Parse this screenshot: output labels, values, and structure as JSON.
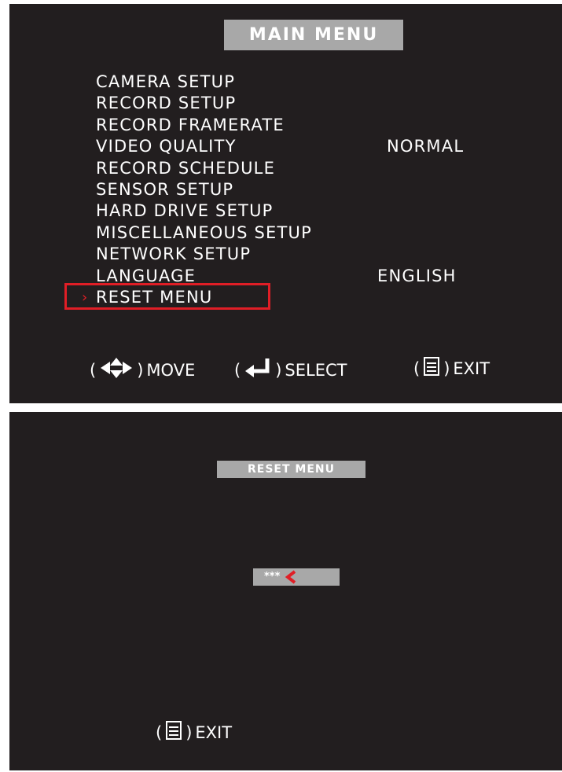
{
  "main_menu": {
    "title": "MAIN MENU",
    "items": [
      {
        "label": "CAMERA SETUP",
        "value": ""
      },
      {
        "label": "RECORD SETUP",
        "value": ""
      },
      {
        "label": "RECORD FRAMERATE",
        "value": ""
      },
      {
        "label": "VIDEO QUALITY",
        "value": "NORMAL"
      },
      {
        "label": "RECORD SCHEDULE",
        "value": ""
      },
      {
        "label": "SENSOR SETUP",
        "value": ""
      },
      {
        "label": "HARD DRIVE SETUP",
        "value": ""
      },
      {
        "label": "MISCELLANEOUS SETUP",
        "value": ""
      },
      {
        "label": "NETWORK SETUP",
        "value": ""
      },
      {
        "label": "LANGUAGE",
        "value": "ENGLISH"
      },
      {
        "label": "RESET MENU",
        "value": ""
      }
    ],
    "selected_label": "RESET MENU",
    "cursor_glyph": "›",
    "footer": {
      "move_label": "MOVE",
      "select_label": "SELECT",
      "exit_label": "EXIT",
      "paren_open": "(",
      "paren_close": ")"
    }
  },
  "reset_menu": {
    "title": "RESET MENU",
    "password_value": "***",
    "exit_label": "EXIT",
    "paren_open": "(",
    "paren_close": ")"
  },
  "icons": {
    "move": "four-way-arrow-icon",
    "select": "enter-icon",
    "exit": "menu-icon",
    "cursor": "red-chevron-icon"
  },
  "colors": {
    "screen_bg": "#221e1f",
    "title_bar": "#a8a8a8",
    "highlight": "#e01e26",
    "text": "#ffffff"
  }
}
